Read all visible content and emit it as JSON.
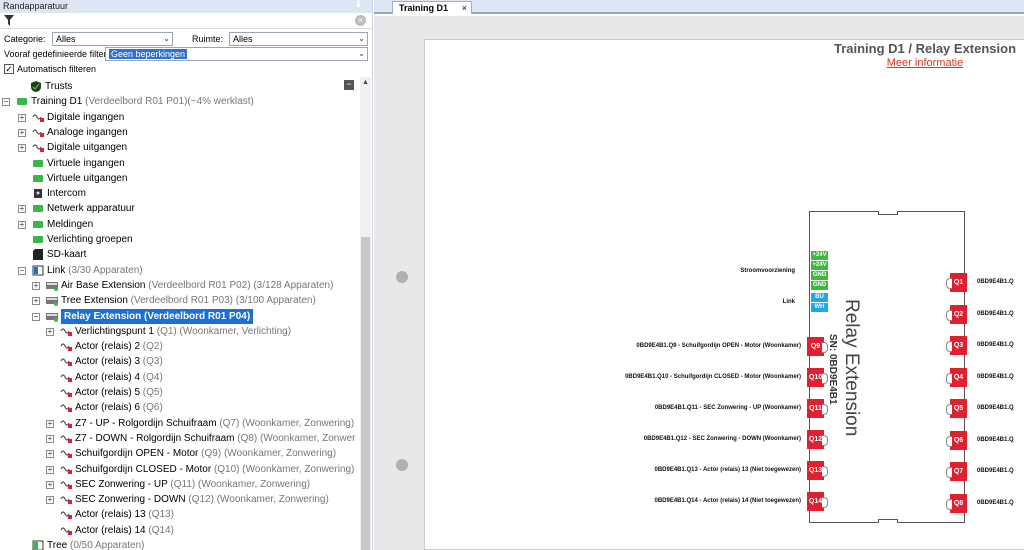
{
  "panel": {
    "title": "Randapparatuur",
    "pin_glyph": "⇓",
    "categorie_label": "Categorie:",
    "categorie_value": "Alles",
    "ruimte_label": "Ruimte:",
    "ruimte_value": "Alles",
    "filters_label": "Vooraf gedefinieerde filters",
    "filters_value": "Geen beperkingen",
    "auto_filter_label": "Automatisch filteren",
    "auto_filter_checked": "✓"
  },
  "tree": [
    {
      "label": "Trusts",
      "gray": "",
      "icon": "trusts-icon"
    },
    {
      "label": "Training D1",
      "gray": "(Verdeelbord R01 P01)(~4% werklast)",
      "icon": "controller-icon"
    },
    {
      "label": "Digitale ingangen",
      "gray": "",
      "icon": "digital-input-icon"
    },
    {
      "label": "Analoge ingangen",
      "gray": "",
      "icon": "analog-input-icon"
    },
    {
      "label": "Digitale uitgangen",
      "gray": "",
      "icon": "digital-output-icon"
    },
    {
      "label": "Virtuele ingangen",
      "gray": "",
      "icon": "virtual-input-icon"
    },
    {
      "label": "Virtuele uitgangen",
      "gray": "",
      "icon": "virtual-output-icon"
    },
    {
      "label": "Intercom",
      "gray": "",
      "icon": "intercom-icon"
    },
    {
      "label": "Netwerk apparatuur",
      "gray": "",
      "icon": "network-icon"
    },
    {
      "label": "Meldingen",
      "gray": "",
      "icon": "notification-icon"
    },
    {
      "label": "Verlichting groepen",
      "gray": "",
      "icon": "lighting-group-icon"
    },
    {
      "label": "SD-kaart",
      "gray": "",
      "icon": "sd-card-icon"
    },
    {
      "label": "Link",
      "gray": "(3/30 Apparaten)",
      "icon": "link-icon"
    },
    {
      "label": "Air Base Extension",
      "gray": "(Verdeelbord R01 P02) (3/128 Apparaten)",
      "icon": "extension-icon"
    },
    {
      "label": "Tree Extension",
      "gray": "(Verdeelbord R01 P03) (3/100 Apparaten)",
      "icon": "extension-icon"
    },
    {
      "label": "Relay Extension (Verdeelbord R01 P04)",
      "gray": "",
      "icon": "extension-icon"
    },
    {
      "label": "Verlichtingspunt 1",
      "gray": "(Q1) (Woonkamer, Verlichting)",
      "icon": "output-icon"
    },
    {
      "label": "Actor (relais) 2",
      "gray": "(Q2)",
      "icon": "output-icon"
    },
    {
      "label": "Actor (relais) 3",
      "gray": "(Q3)",
      "icon": "output-icon"
    },
    {
      "label": "Actor (relais) 4",
      "gray": "(Q4)",
      "icon": "output-icon"
    },
    {
      "label": "Actor (relais) 5",
      "gray": "(Q5)",
      "icon": "output-icon"
    },
    {
      "label": "Actor (relais) 6",
      "gray": "(Q6)",
      "icon": "output-icon"
    },
    {
      "label": "Z7 - UP - Rolgordijn Schuifraam",
      "gray": "(Q7) (Woonkamer, Zonwering)",
      "icon": "output-icon"
    },
    {
      "label": "Z7 - DOWN - Rolgordijn Schuifraam",
      "gray": "(Q8) (Woonkamer, Zonwer",
      "icon": "output-icon"
    },
    {
      "label": "Schuifgordijn OPEN - Motor",
      "gray": "(Q9) (Woonkamer, Zonwering)",
      "icon": "output-icon"
    },
    {
      "label": "Schuifgordijn CLOSED - Motor",
      "gray": "(Q10) (Woonkamer, Zonwering)",
      "icon": "output-icon"
    },
    {
      "label": "SEC Zonwering - UP",
      "gray": "(Q11) (Woonkamer, Zonwering)",
      "icon": "output-icon"
    },
    {
      "label": "SEC Zonwering - DOWN",
      "gray": "(Q12) (Woonkamer, Zonwering)",
      "icon": "output-icon"
    },
    {
      "label": "Actor (relais) 13",
      "gray": "(Q13)",
      "icon": "output-icon"
    },
    {
      "label": "Actor (relais) 14",
      "gray": "(Q14)",
      "icon": "output-icon"
    },
    {
      "label": "Tree",
      "gray": "(0/50 Apparaten)",
      "icon": "tree-icon"
    }
  ],
  "tab": {
    "label": "Training D1",
    "close": "×"
  },
  "page": {
    "title": "Training D1 / Relay Extension",
    "link": "Meer informatie",
    "module_name": "Relay Extension",
    "serial": "SN: 0BD9E4B1"
  },
  "power_pins": [
    "+24V",
    "+24V",
    "GND",
    "GND"
  ],
  "link_pins": [
    "BU",
    "WH"
  ],
  "power_label": "Stroomvoorziening",
  "link_label": "Link",
  "left_outputs": [
    {
      "q": "Q9",
      "label": "0BD9E4B1.Q9 - Schuifgordijn OPEN - Motor (Woonkamer)"
    },
    {
      "q": "Q10",
      "label": "0BD9E4B1.Q10 - Schuifgordijn CLOSED - Motor (Woonkamer)"
    },
    {
      "q": "Q11",
      "label": "0BD9E4B1.Q11 - SEC Zonwering - UP (Woonkamer)"
    },
    {
      "q": "Q12",
      "label": "0BD9E4B1.Q12 - SEC Zonwering - DOWN (Woonkamer)"
    },
    {
      "q": "Q13",
      "label": "0BD9E4B1.Q13 - Actor (relais) 13 (Niet toegewezen)"
    },
    {
      "q": "Q14",
      "label": "0BD9E4B1.Q14 - Actor (relais) 14 (Niet toegewezen)"
    }
  ],
  "right_outputs": [
    {
      "q": "Q1",
      "label": "0BD9E4B1.Q"
    },
    {
      "q": "Q2",
      "label": "0BD9E4B1.Q"
    },
    {
      "q": "Q3",
      "label": "0BD9E4B1.Q"
    },
    {
      "q": "Q4",
      "label": "0BD9E4B1.Q"
    },
    {
      "q": "Q5",
      "label": "0BD9E4B1.Q"
    },
    {
      "q": "Q6",
      "label": "0BD9E4B1.Q"
    },
    {
      "q": "Q7",
      "label": "0BD9E4B1.Q"
    },
    {
      "q": "Q8",
      "label": "0BD9E4B1.Q"
    }
  ],
  "colors": {
    "accent": "#1c6fd9",
    "output": "#e02030",
    "power": "#3cba3c",
    "link": "#1da8e6"
  }
}
